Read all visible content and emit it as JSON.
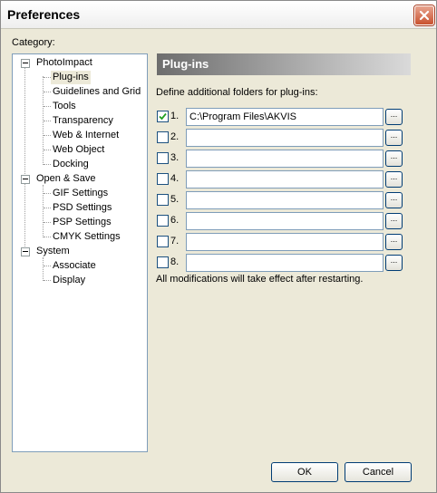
{
  "window": {
    "title": "Preferences"
  },
  "category_label": "Category:",
  "tree": {
    "nodes": [
      {
        "label": "PhotoImpact"
      },
      {
        "label": "Plug-ins",
        "selected": true
      },
      {
        "label": "Guidelines and Grid"
      },
      {
        "label": "Tools"
      },
      {
        "label": "Transparency"
      },
      {
        "label": "Web & Internet"
      },
      {
        "label": "Web Object"
      },
      {
        "label": "Docking"
      },
      {
        "label": "Open & Save"
      },
      {
        "label": "GIF Settings"
      },
      {
        "label": "PSD Settings"
      },
      {
        "label": "PSP Settings"
      },
      {
        "label": "CMYK Settings"
      },
      {
        "label": "System"
      },
      {
        "label": "Associate"
      },
      {
        "label": "Display"
      }
    ]
  },
  "panel": {
    "header": "Plug-ins",
    "define_label": "Define additional folders for plug-ins:",
    "browse_label": "...",
    "rows": [
      {
        "number": "1.",
        "checked": true,
        "value": "C:\\Program Files\\AKVIS"
      },
      {
        "number": "2.",
        "checked": false,
        "value": ""
      },
      {
        "number": "3.",
        "checked": false,
        "value": ""
      },
      {
        "number": "4.",
        "checked": false,
        "value": ""
      },
      {
        "number": "5.",
        "checked": false,
        "value": ""
      },
      {
        "number": "6.",
        "checked": false,
        "value": ""
      },
      {
        "number": "7.",
        "checked": false,
        "value": ""
      },
      {
        "number": "8.",
        "checked": false,
        "value": ""
      }
    ],
    "note": "All modifications will take effect after restarting."
  },
  "buttons": {
    "ok": "OK",
    "cancel": "Cancel"
  }
}
